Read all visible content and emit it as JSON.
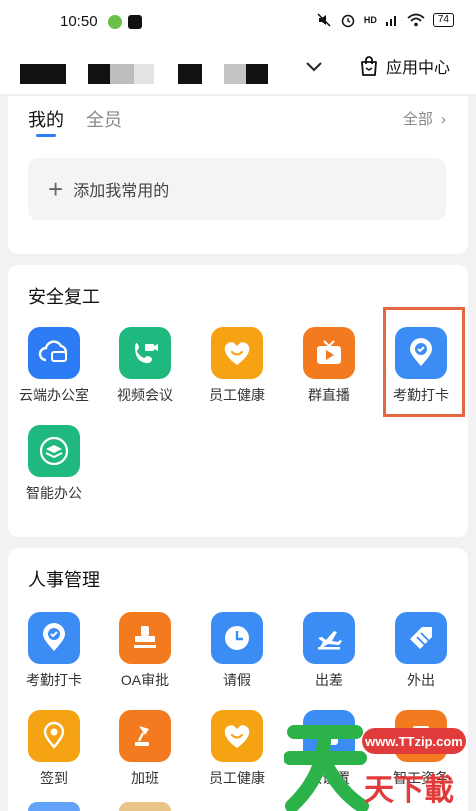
{
  "status_bar": {
    "time": "10:50",
    "signal_label": "HD",
    "battery": "74"
  },
  "header": {
    "app_center_label": "应用中心"
  },
  "mine_card": {
    "tabs": [
      "我的",
      "全员"
    ],
    "all_label": "全部",
    "add_label": "添加我常用的"
  },
  "safe_work": {
    "title": "安全复工",
    "apps": [
      {
        "label": "云端办公室",
        "icon": "cloud-monitor-icon",
        "color": "#2d7cf6"
      },
      {
        "label": "视频会议",
        "icon": "video-call-icon",
        "color": "#1fb980"
      },
      {
        "label": "员工健康",
        "icon": "heart-icon",
        "color": "#f5a312"
      },
      {
        "label": "群直播",
        "icon": "tv-play-icon",
        "color": "#f47a1f"
      },
      {
        "label": "考勤打卡",
        "icon": "location-check-icon",
        "color": "#3b8cf5"
      },
      {
        "label": "智能办公",
        "icon": "layers-icon",
        "color": "#1fb980"
      }
    ]
  },
  "hr": {
    "title": "人事管理",
    "apps": [
      {
        "label": "考勤打卡",
        "icon": "location-check-icon",
        "color": "#3b8cf5"
      },
      {
        "label": "OA审批",
        "icon": "stamp-icon",
        "color": "#f47a1f"
      },
      {
        "label": "请假",
        "icon": "clock-icon",
        "color": "#3b8cf5"
      },
      {
        "label": "出差",
        "icon": "plane-icon",
        "color": "#3b8cf5"
      },
      {
        "label": "外出",
        "icon": "tag-icon",
        "color": "#3b8cf5"
      },
      {
        "label": "签到",
        "icon": "pin-icon",
        "color": "#f5a312"
      },
      {
        "label": "加班",
        "icon": "lamp-icon",
        "color": "#f47a1f"
      },
      {
        "label": "员工健康",
        "icon": "heart-icon",
        "color": "#f5a312"
      },
      {
        "label": "认设置",
        "icon": "app-icon",
        "color": "#3b8cf5"
      },
      {
        "label": "智工资条",
        "icon": "doc-icon",
        "color": "#f47a1f"
      }
    ]
  },
  "watermark": {
    "text": "www.TTzip.com",
    "brand": "天下載"
  }
}
